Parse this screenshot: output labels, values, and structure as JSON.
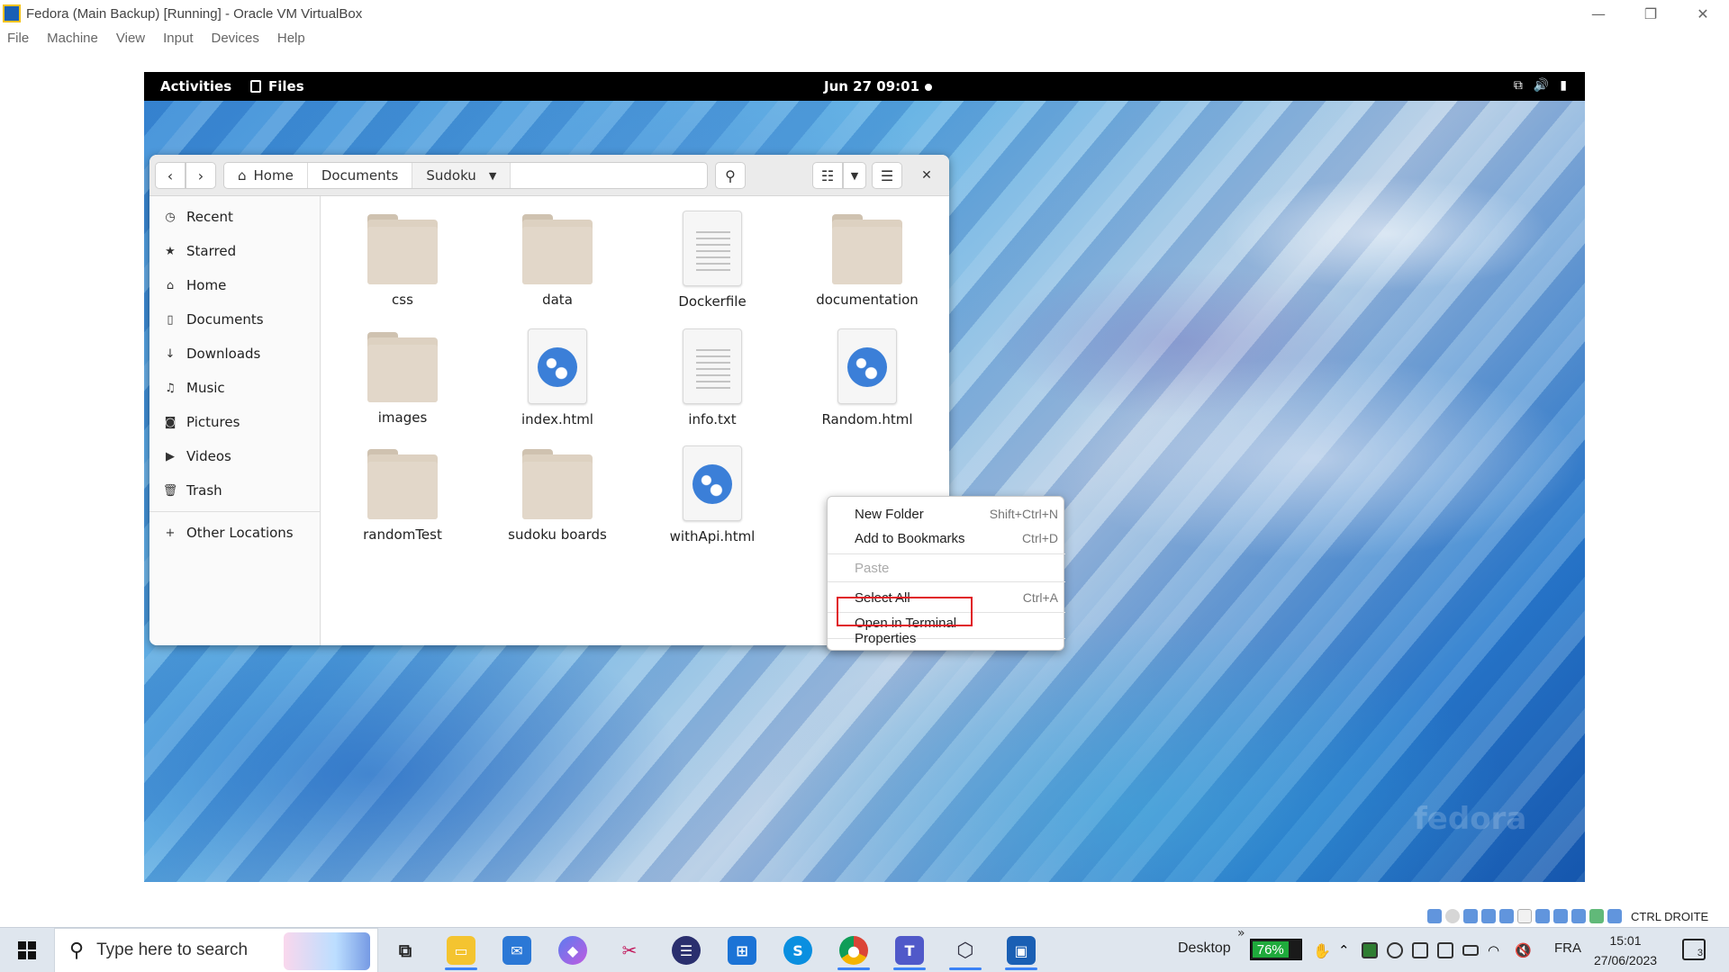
{
  "host": {
    "title": "Fedora (Main Backup) [Running] - Oracle VM VirtualBox",
    "menu": [
      "File",
      "Machine",
      "View",
      "Input",
      "Devices",
      "Help"
    ],
    "window_buttons": {
      "minimize": "—",
      "restore": "❐",
      "close": "✕"
    }
  },
  "gnome": {
    "activities": "Activities",
    "app_name": "Files",
    "clock": "Jun 27  09:01",
    "tray_icons": [
      "network-icon",
      "volume-icon",
      "battery-icon"
    ]
  },
  "files": {
    "path": [
      "Home",
      "Documents",
      "Sudoku"
    ],
    "sidebar": [
      {
        "label": "Recent",
        "icon": "clock-icon"
      },
      {
        "label": "Starred",
        "icon": "star-icon"
      },
      {
        "label": "Home",
        "icon": "home-icon"
      },
      {
        "label": "Documents",
        "icon": "document-icon"
      },
      {
        "label": "Downloads",
        "icon": "download-icon"
      },
      {
        "label": "Music",
        "icon": "music-icon"
      },
      {
        "label": "Pictures",
        "icon": "camera-icon"
      },
      {
        "label": "Videos",
        "icon": "video-icon"
      },
      {
        "label": "Trash",
        "icon": "trash-icon"
      }
    ],
    "other_locations": "Other Locations",
    "items": [
      {
        "name": "css",
        "type": "folder"
      },
      {
        "name": "data",
        "type": "folder"
      },
      {
        "name": "Dockerfile",
        "type": "text"
      },
      {
        "name": "documentation",
        "type": "folder"
      },
      {
        "name": "images",
        "type": "folder"
      },
      {
        "name": "index.html",
        "type": "html"
      },
      {
        "name": "info.txt",
        "type": "text"
      },
      {
        "name": "Random.html",
        "type": "html"
      },
      {
        "name": "randomTest",
        "type": "folder"
      },
      {
        "name": "sudoku boards",
        "type": "folder"
      },
      {
        "name": "withApi.html",
        "type": "html"
      }
    ]
  },
  "context_menu": {
    "new_folder": "New Folder",
    "new_folder_shortcut": "Shift+Ctrl+N",
    "add_bookmarks": "Add to Bookmarks",
    "add_bookmarks_shortcut": "Ctrl+D",
    "paste": "Paste",
    "select_all": "Select All",
    "select_all_shortcut": "Ctrl+A",
    "open_terminal": "Open in Terminal",
    "properties": "Properties"
  },
  "watermark": "fedora",
  "taskbar": {
    "search_placeholder": "Type here to search",
    "desktop": "Desktop",
    "battery": "76%",
    "battery_level": 0.76,
    "language": "FRA",
    "time": "15:01",
    "date": "27/06/2023",
    "notifications": "3",
    "host_key": "CTRL DROITE",
    "chevron": "»"
  }
}
